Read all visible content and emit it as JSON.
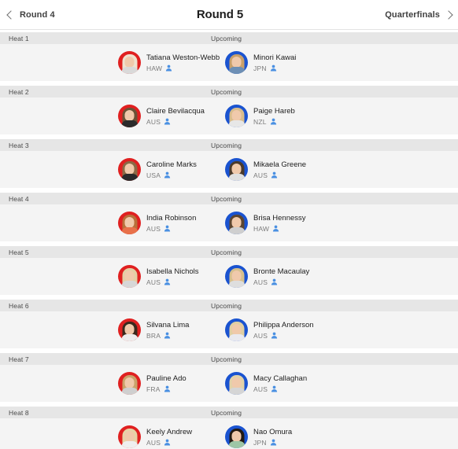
{
  "nav": {
    "prev_label": "Round 4",
    "title": "Round 5",
    "next_label": "Quarterfinals",
    "prev_icon": "chevron-left-icon",
    "next_icon": "chevron-right-icon"
  },
  "colors": {
    "avatar_red": "#e02020",
    "avatar_blue": "#1a53d0",
    "heat_header_bg": "#e6e6e6",
    "heat_body_bg": "#f4f4f4",
    "page_bg": "#ffffff",
    "name_text": "#1d1d1d",
    "country_text": "#7b7b7b",
    "person_icon": "#4a90e2"
  },
  "heats": [
    {
      "label": "Heat 1",
      "status": "Upcoming",
      "athletes": [
        {
          "name": "Tatiana Weston-Webb",
          "country": "HAW",
          "color": "red",
          "hair": "#efe2cf",
          "top": "#d9d9d9",
          "icon": "person-icon"
        },
        {
          "name": "Minori Kawai",
          "country": "JPN",
          "color": "blue",
          "hair": "#c9a06a",
          "top": "#6d8fb5",
          "icon": "person-icon"
        }
      ]
    },
    {
      "label": "Heat 2",
      "status": "Upcoming",
      "athletes": [
        {
          "name": "Claire Bevilacqua",
          "country": "AUS",
          "color": "red",
          "hair": "#6b5236",
          "top": "#2b2b2b",
          "icon": "person-icon"
        },
        {
          "name": "Paige Hareb",
          "country": "NZL",
          "color": "blue",
          "hair": "#d8bd8c",
          "top": "#e7e7e7",
          "icon": "person-icon"
        }
      ]
    },
    {
      "label": "Heat 3",
      "status": "Upcoming",
      "athletes": [
        {
          "name": "Caroline Marks",
          "country": "USA",
          "color": "red",
          "hair": "#8a6a45",
          "top": "#2a2a2a",
          "icon": "person-icon"
        },
        {
          "name": "Mikaela Greene",
          "country": "AUS",
          "color": "blue",
          "hair": "#4b3a2a",
          "top": "#e0e0e0",
          "icon": "person-icon"
        }
      ]
    },
    {
      "label": "Heat 4",
      "status": "Upcoming",
      "athletes": [
        {
          "name": "India Robinson",
          "country": "AUS",
          "color": "red",
          "hair": "#b8703a",
          "top": "#e8714a",
          "icon": "person-icon"
        },
        {
          "name": "Brisa Hennessy",
          "country": "HAW",
          "color": "blue",
          "hair": "#5c4631",
          "top": "#cfcfcf",
          "icon": "person-icon"
        }
      ]
    },
    {
      "label": "Heat 5",
      "status": "Upcoming",
      "athletes": [
        {
          "name": "Isabella Nichols",
          "country": "AUS",
          "color": "red",
          "hair": "#e3cfa4",
          "top": "#d7d7d7",
          "icon": "person-icon"
        },
        {
          "name": "Bronte Macaulay",
          "country": "AUS",
          "color": "blue",
          "hair": "#d6c08d",
          "top": "#dedede",
          "icon": "person-icon"
        }
      ]
    },
    {
      "label": "Heat 6",
      "status": "Upcoming",
      "athletes": [
        {
          "name": "Silvana Lima",
          "country": "BRA",
          "color": "red",
          "hair": "#3a2a1d",
          "top": "#ededed",
          "icon": "person-icon"
        },
        {
          "name": "Philippa Anderson",
          "country": "AUS",
          "color": "blue",
          "hair": "#e0cfa2",
          "top": "#e9e9ef",
          "icon": "person-icon"
        }
      ]
    },
    {
      "label": "Heat 7",
      "status": "Upcoming",
      "athletes": [
        {
          "name": "Pauline Ado",
          "country": "FRA",
          "color": "red",
          "hair": "#c9a36a",
          "top": "#cfcfcf",
          "icon": "person-icon"
        },
        {
          "name": "Macy Callaghan",
          "country": "AUS",
          "color": "blue",
          "hair": "#e2d2a8",
          "top": "#d5d5d5",
          "icon": "person-icon"
        }
      ]
    },
    {
      "label": "Heat 8",
      "status": "Upcoming",
      "athletes": [
        {
          "name": "Keely Andrew",
          "country": "AUS",
          "color": "red",
          "hair": "#e6d3a6",
          "top": "#efefef",
          "icon": "person-icon"
        },
        {
          "name": "Nao Omura",
          "country": "JPN",
          "color": "blue",
          "hair": "#231a12",
          "top": "#9ec6a6",
          "icon": "person-icon"
        }
      ]
    }
  ]
}
